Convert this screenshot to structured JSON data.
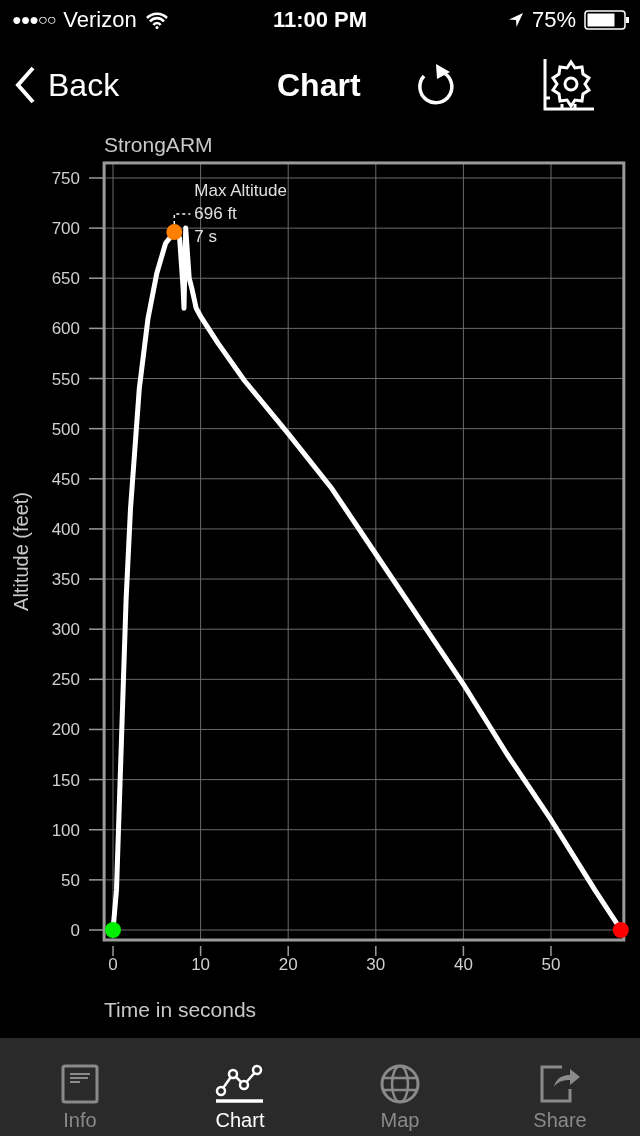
{
  "status_bar": {
    "signal": "●●●○○",
    "carrier": "Verizon",
    "time": "11:00 PM",
    "battery": "75%"
  },
  "nav_bar": {
    "back": "Back",
    "title": "Chart"
  },
  "chart": {
    "chart_data": {
      "type": "line",
      "title": "StrongARM",
      "xlabel": "Time in seconds",
      "ylabel": "Altitude (feet)",
      "xlim": [
        -0.9,
        58.2
      ],
      "ylim": [
        -10,
        765
      ],
      "xticks": [
        0,
        10,
        20,
        30,
        40,
        50
      ],
      "yticks": [
        0,
        50,
        100,
        150,
        200,
        250,
        300,
        350,
        400,
        450,
        500,
        550,
        600,
        650,
        700,
        750
      ],
      "x": [
        0,
        0.4,
        1,
        1.5,
        2,
        3,
        4,
        5,
        6,
        7,
        7.6,
        8,
        8.1,
        8.3,
        8.7,
        9,
        9.5,
        10,
        12,
        15,
        20,
        25,
        30,
        35,
        40,
        45,
        50,
        55,
        58
      ],
      "grid": true,
      "series": [
        {
          "color": "#ffffff",
          "values": [
            0,
            40,
            200,
            330,
            420,
            540,
            610,
            655,
            685,
            696,
            690,
            640,
            620,
            700,
            650,
            640,
            620,
            612,
            585,
            548,
            495,
            440,
            375,
            310,
            245,
            175,
            110,
            40,
            0
          ]
        }
      ],
      "annotations": [
        {
          "x": 7,
          "y": 696,
          "text": "Max Altitude\n696 ft\n7  s"
        }
      ]
    },
    "markers": [
      {
        "kind": "start",
        "color": "#00ee00"
      },
      {
        "kind": "peak",
        "color": "#ff7f00"
      },
      {
        "kind": "end",
        "color": "#ff0000"
      }
    ]
  },
  "tabs": [
    {
      "label": "Info",
      "kind": "info",
      "selected": false
    },
    {
      "label": "Chart",
      "kind": "chart",
      "selected": true
    },
    {
      "label": "Map",
      "kind": "map",
      "selected": false
    },
    {
      "label": "Share",
      "kind": "share",
      "selected": false
    }
  ]
}
